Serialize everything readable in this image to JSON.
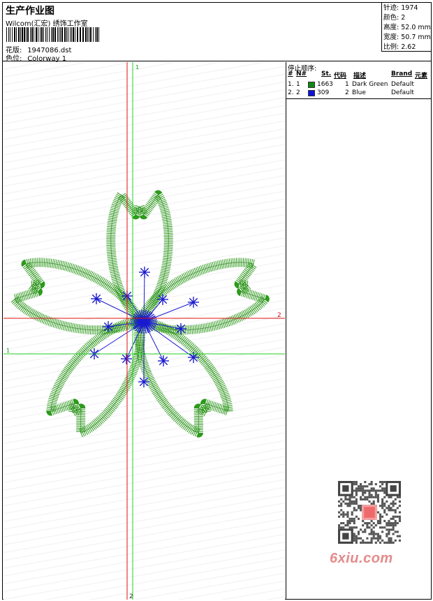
{
  "header": {
    "title": "生产作业图",
    "subtitle": "Wilcom(汇宏) 绣饰工作室",
    "design_label": "花版:",
    "design_value": "1947086.dst",
    "colorway_label": "色位:",
    "colorway_value": "Colorway 1"
  },
  "stats": [
    {
      "label": "针迹:",
      "value": "1974"
    },
    {
      "label": "颜色:",
      "value": "2"
    },
    {
      "label": "高度:",
      "value": "52.0 mm"
    },
    {
      "label": "宽度:",
      "value": "50.7 mm"
    },
    {
      "label": "比例:",
      "value": "2.62"
    }
  ],
  "axes": {
    "red_vertical_top": "1",
    "red_horizontal_right": "2",
    "green_horizontal_left": "1",
    "red_vertical_bottom": "2"
  },
  "stop_sequence": {
    "caption": "停止顺序:",
    "columns": [
      "#",
      "N#",
      "St.",
      "代码",
      "描述",
      "Brand",
      "元素"
    ],
    "rows": [
      {
        "seq": "1.",
        "needle": "1",
        "stitches": "1663",
        "code": "1",
        "description": "Dark Green",
        "brand": "Default",
        "color": "#118811"
      },
      {
        "seq": "2.",
        "needle": "2",
        "stitches": "309",
        "code": "2",
        "description": "Blue",
        "brand": "Default",
        "color": "#1010dd"
      }
    ]
  },
  "colors": {
    "thread_green": "#2e9a1c",
    "thread_blue": "#1a1ad0",
    "axis_red": "#e01010",
    "axis_green": "#20d020"
  },
  "watermark": {
    "brand": "6xiu.com"
  }
}
